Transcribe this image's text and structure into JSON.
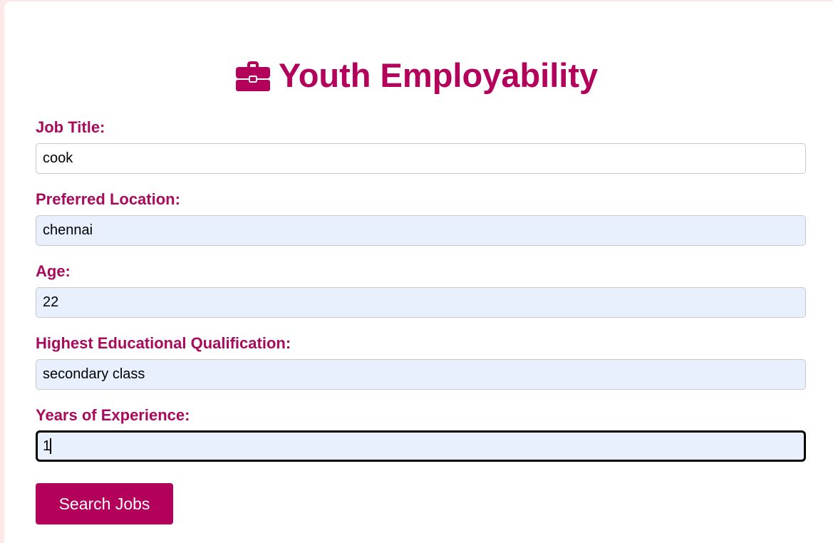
{
  "header": {
    "icon": "briefcase-icon",
    "title": "Youth Employability"
  },
  "form": {
    "job_title": {
      "label": "Job Title:",
      "value": "cook"
    },
    "location": {
      "label": "Preferred Location:",
      "value": "chennai"
    },
    "age": {
      "label": "Age:",
      "value": "22"
    },
    "qualification": {
      "label": "Highest Educational Qualification:",
      "value": "secondary class"
    },
    "experience": {
      "label": "Years of Experience:",
      "value": "1"
    },
    "submit_label": "Search Jobs"
  },
  "colors": {
    "accent": "#b3005a",
    "label": "#a80a5c",
    "autofill_bg": "#e8f0fe",
    "page_bg": "#fde8ea"
  }
}
